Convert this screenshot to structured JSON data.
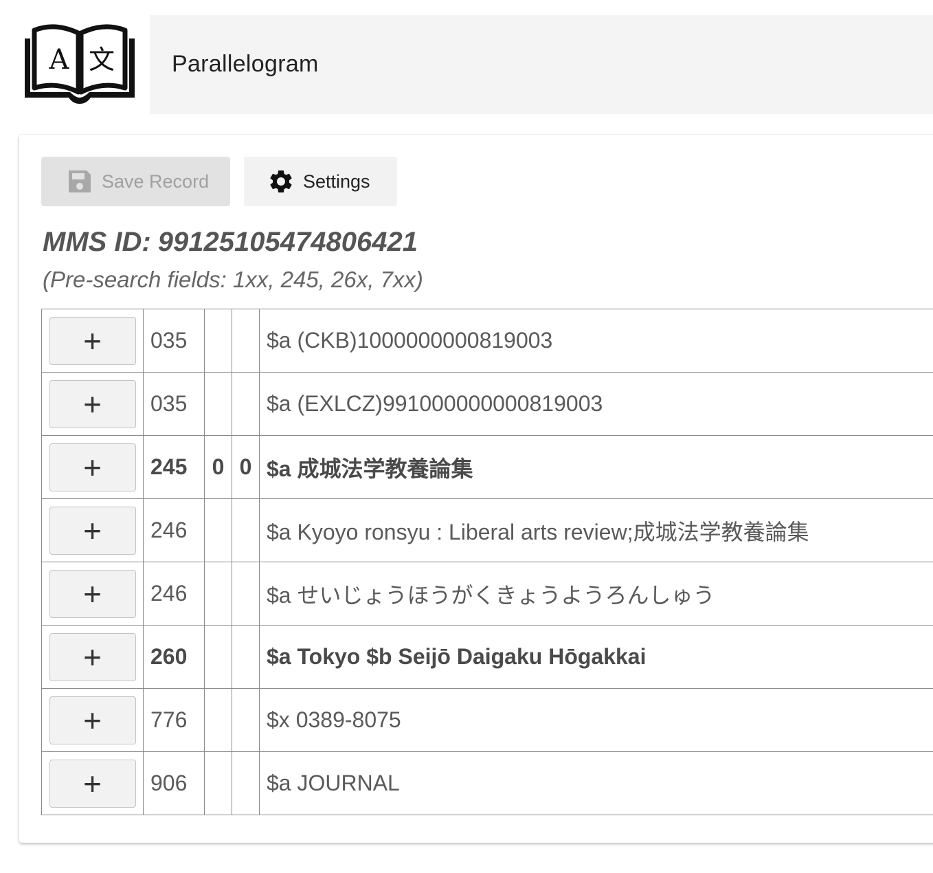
{
  "app": {
    "title": "Parallelogram",
    "logo_icon": "book-translate-icon",
    "logo_letters": [
      "A",
      "文"
    ]
  },
  "toolbar": {
    "save_label": "Save Record",
    "save_icon": "floppy-disk-icon",
    "save_disabled": true,
    "settings_label": "Settings",
    "settings_icon": "gear-icon"
  },
  "record": {
    "mms_label": "MMS ID:",
    "mms_id": "99125105474806421",
    "presearch_note": "(Pre-search fields: 1xx, 245, 26x, 7xx)"
  },
  "fields": [
    {
      "add_label": "+",
      "tag": "035",
      "ind1": "",
      "ind2": "",
      "subfields": "$a (CKB)1000000000819003",
      "bold": false
    },
    {
      "add_label": "+",
      "tag": "035",
      "ind1": "",
      "ind2": "",
      "subfields": "$a (EXLCZ)991000000000819003",
      "bold": false
    },
    {
      "add_label": "+",
      "tag": "245",
      "ind1": "0",
      "ind2": "0",
      "subfields": "$a 成城法学教養論集",
      "bold": true
    },
    {
      "add_label": "+",
      "tag": "246",
      "ind1": "",
      "ind2": "",
      "subfields": "$a Kyoyo ronsyu : Liberal arts review;成城法学教養論集",
      "bold": false
    },
    {
      "add_label": "+",
      "tag": "246",
      "ind1": "",
      "ind2": "",
      "subfields": "$a せいじょうほうがくきょうようろんしゅう",
      "bold": false
    },
    {
      "add_label": "+",
      "tag": "260",
      "ind1": "",
      "ind2": "",
      "subfields": "$a Tokyo $b Seijō Daigaku Hōgakkai",
      "bold": true
    },
    {
      "add_label": "+",
      "tag": "776",
      "ind1": "",
      "ind2": "",
      "subfields": "$x 0389-8075",
      "bold": false
    },
    {
      "add_label": "+",
      "tag": "906",
      "ind1": "",
      "ind2": "",
      "subfields": "$a JOURNAL",
      "bold": false
    }
  ],
  "colors": {
    "app_bar_bg": "#f4f4f4",
    "button_bg": "#f2f2f2",
    "disabled_button_bg": "#e2e2e2",
    "disabled_text": "#a0a0a0",
    "border": "#8a8a8a"
  }
}
